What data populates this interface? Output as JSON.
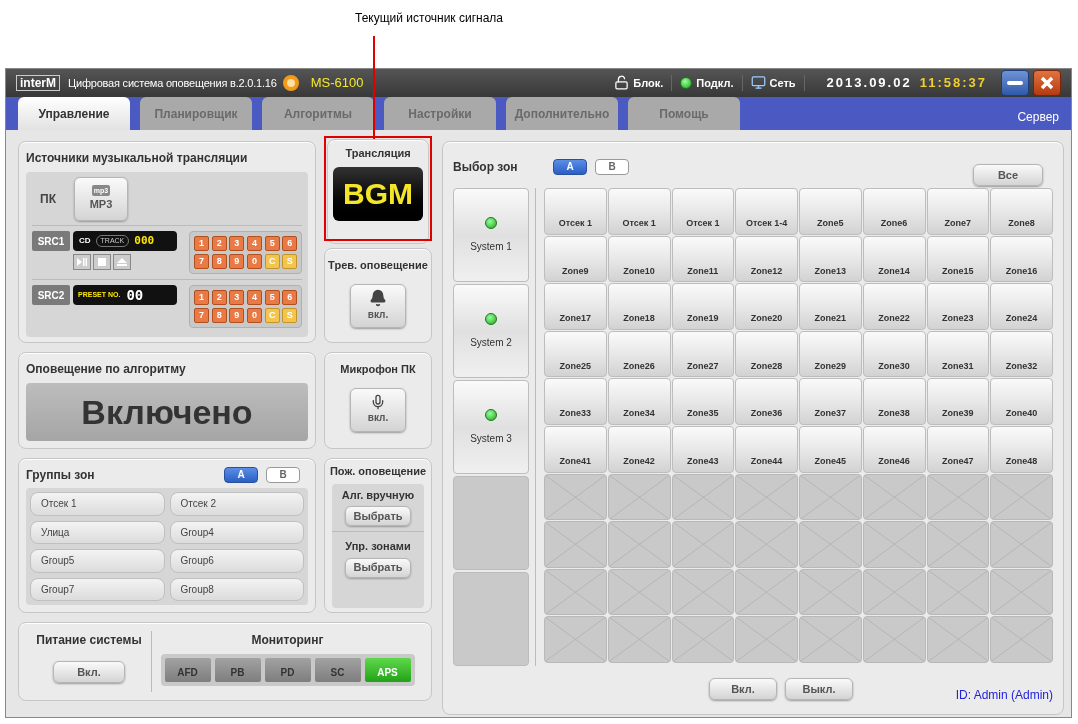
{
  "annotation": {
    "text": "Текущий источник сигнала"
  },
  "title_bar": {
    "logo": "interM",
    "title": "Цифровая система оповещения в.2.0.1.16",
    "model": "MS-6100",
    "status": [
      {
        "kind": "lock",
        "label": "Блок."
      },
      {
        "kind": "led",
        "label": "Подкл."
      },
      {
        "kind": "network",
        "label": "Сеть"
      }
    ],
    "date": "2013.09.02",
    "time": "11:58:37"
  },
  "tabs": [
    {
      "label": "Управление",
      "selected": true
    },
    {
      "label": "Планировщик",
      "selected": false
    },
    {
      "label": "Алгоритмы",
      "selected": false
    },
    {
      "label": "Настройки",
      "selected": false
    },
    {
      "label": "Дополнительно",
      "selected": false
    },
    {
      "label": "Помощь",
      "selected": false
    }
  ],
  "server_label": "Сервер",
  "music_sources": {
    "title": "Источники музыкальной трансляции",
    "pc_label": "ПК",
    "mp3_icon_text": "mp3",
    "mp3_button": "MP3",
    "src1": {
      "label": "SRC1",
      "media": "CD",
      "track_label": "TRACK",
      "track": "000"
    },
    "src2": {
      "label": "SRC2",
      "preset_label": "PRESET NO.",
      "preset": "00"
    },
    "src1_keys": [
      {
        "label": "1",
        "kind": "digit"
      },
      {
        "label": "2",
        "kind": "digit"
      },
      {
        "label": "3",
        "kind": "digit"
      },
      {
        "label": "4",
        "kind": "digit"
      },
      {
        "label": "5",
        "kind": "digit"
      },
      {
        "label": "6",
        "kind": "digit"
      },
      {
        "label": "7",
        "kind": "digit"
      },
      {
        "label": "8",
        "kind": "digit"
      },
      {
        "label": "9",
        "kind": "digit"
      },
      {
        "label": "0",
        "kind": "digit"
      },
      {
        "label": "C",
        "kind": "function"
      },
      {
        "label": "S",
        "kind": "function"
      }
    ],
    "src2_keys": [
      {
        "label": "1",
        "kind": "digit"
      },
      {
        "label": "2",
        "kind": "digit"
      },
      {
        "label": "3",
        "kind": "digit"
      },
      {
        "label": "4",
        "kind": "digit"
      },
      {
        "label": "5",
        "kind": "digit"
      },
      {
        "label": "6",
        "kind": "digit"
      },
      {
        "label": "7",
        "kind": "digit"
      },
      {
        "label": "8",
        "kind": "digit"
      },
      {
        "label": "9",
        "kind": "digit"
      },
      {
        "label": "0",
        "kind": "digit"
      },
      {
        "label": "C",
        "kind": "function"
      },
      {
        "label": "S",
        "kind": "function"
      }
    ]
  },
  "broadcast": {
    "title": "Трансляция",
    "value": "BGM"
  },
  "alarm": {
    "title": "Трев. оповещение",
    "button": "вкл."
  },
  "algorithm": {
    "title": "Оповещение по алгоритму",
    "status": "Включено"
  },
  "mic": {
    "title": "Микрофон ПК",
    "button": "вкл."
  },
  "zone_groups": {
    "title": "Группы зон",
    "banks": [
      {
        "label": "A",
        "selected": true
      },
      {
        "label": "B",
        "selected": false
      }
    ],
    "groups": [
      "Отсек 1",
      "Отсек 2",
      "Улица",
      "Group4",
      "Group5",
      "Group6",
      "Group7",
      "Group8"
    ]
  },
  "fire": {
    "title": "Пож. оповещение",
    "sections": [
      {
        "label": "Алг. вручную",
        "button": "Выбрать"
      },
      {
        "label": "Упр. зонами",
        "button": "Выбрать"
      }
    ]
  },
  "power": {
    "title": "Питание системы",
    "button": "Вкл."
  },
  "monitoring": {
    "title": "Мониторинг",
    "indicators": [
      {
        "label": "AFD",
        "on": false
      },
      {
        "label": "PB",
        "on": false
      },
      {
        "label": "PD",
        "on": false
      },
      {
        "label": "SC",
        "on": false
      },
      {
        "label": "APS",
        "on": true
      }
    ]
  },
  "zone_select": {
    "title": "Выбор зон",
    "banks": [
      {
        "label": "A",
        "selected": true
      },
      {
        "label": "B",
        "selected": false
      }
    ],
    "all_button": "Все",
    "systems": [
      {
        "label": "System 1",
        "connected": true
      },
      {
        "label": "System 2",
        "connected": true
      },
      {
        "label": "System 3",
        "connected": true
      }
    ],
    "zones": [
      "Отсек 1",
      "Отсек 1",
      "Отсек 1",
      "Отсек 1-4",
      "Zone5",
      "Zone6",
      "Zone7",
      "Zone8",
      "Zone9",
      "Zone10",
      "Zone11",
      "Zone12",
      "Zone13",
      "Zone14",
      "Zone15",
      "Zone16",
      "Zone17",
      "Zone18",
      "Zone19",
      "Zone20",
      "Zone21",
      "Zone22",
      "Zone23",
      "Zone24",
      "Zone25",
      "Zone26",
      "Zone27",
      "Zone28",
      "Zone29",
      "Zone30",
      "Zone31",
      "Zone32",
      "Zone33",
      "Zone34",
      "Zone35",
      "Zone36",
      "Zone37",
      "Zone38",
      "Zone39",
      "Zone40",
      "Zone41",
      "Zone42",
      "Zone43",
      "Zone44",
      "Zone45",
      "Zone46",
      "Zone47",
      "Zone48"
    ],
    "on_button": "Вкл.",
    "off_button": "Выкл.",
    "user": "ID: Admin (Admin)"
  }
}
